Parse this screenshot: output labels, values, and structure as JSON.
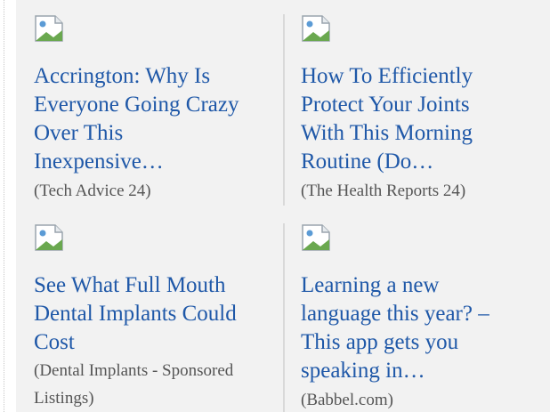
{
  "cards": [
    {
      "title_lines": [
        "Accrington: Why Is",
        "Everyone Going Crazy",
        "Over This",
        "Inexpensive…"
      ],
      "source_lines": [
        "(Tech Advice 24)"
      ],
      "thumb_icon": "broken-image-icon"
    },
    {
      "title_lines": [
        "How To Efficiently",
        "Protect Your Joints",
        "With This Morning",
        "Routine (Do…"
      ],
      "source_lines": [
        "(The Health Reports 24)"
      ],
      "thumb_icon": "broken-image-icon"
    },
    {
      "title_lines": [
        "See What Full Mouth",
        "Dental Implants Could",
        "Cost"
      ],
      "source_lines": [
        "(Dental Implants - Sponsored",
        "Listings)"
      ],
      "thumb_icon": "broken-image-icon"
    },
    {
      "title_lines": [
        "Learning a new",
        "language this year? –",
        "This app gets you",
        "speaking in…"
      ],
      "source_lines": [
        "(Babbel.com)"
      ],
      "thumb_icon": "broken-image-icon"
    }
  ],
  "colors": {
    "link": "#1f58a8",
    "source": "#555555",
    "panel_bg": "#f2f2f2",
    "divider": "#d9d9d9"
  }
}
